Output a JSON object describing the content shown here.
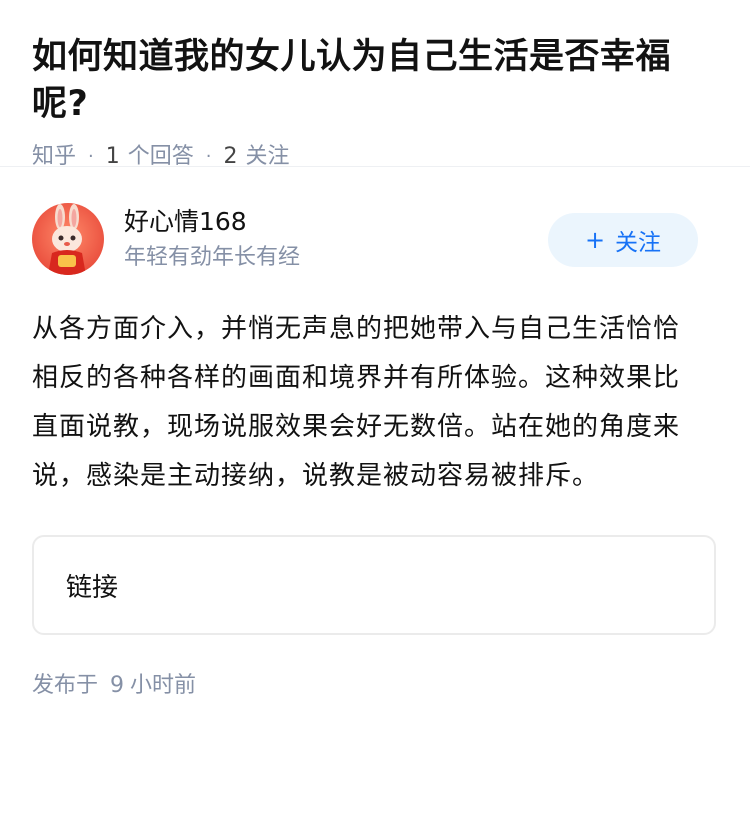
{
  "question": {
    "title": "如何知道我的女儿认为自己生活是否幸福呢?",
    "source": "知乎",
    "answer_count": "1",
    "answer_label": "个回答",
    "follow_count": "2",
    "follow_label": "关注"
  },
  "answer": {
    "author": {
      "name": "好心情168",
      "bio": "年轻有劲年长有经",
      "avatar_icon": "rabbit-avatar-icon"
    },
    "follow_button": {
      "plus": "+",
      "label": "关注"
    },
    "content": "从各方面介入，并悄无声息的把她带入与自己生活恰恰相反的各种各样的画面和境界并有所体验。这种效果比直面说教，现场说服效果会好无数倍。站在她的角度来说，感染是主动接纳，说教是被动容易被排斥。",
    "link_card_label": "链接",
    "publish": {
      "prefix": "发布于",
      "value": "9",
      "unit": "小时前"
    }
  },
  "colors": {
    "accent": "#1772f6",
    "accent_bg": "#ebf5fd",
    "meta_text": "#8590a6",
    "primary_text": "#121212"
  }
}
